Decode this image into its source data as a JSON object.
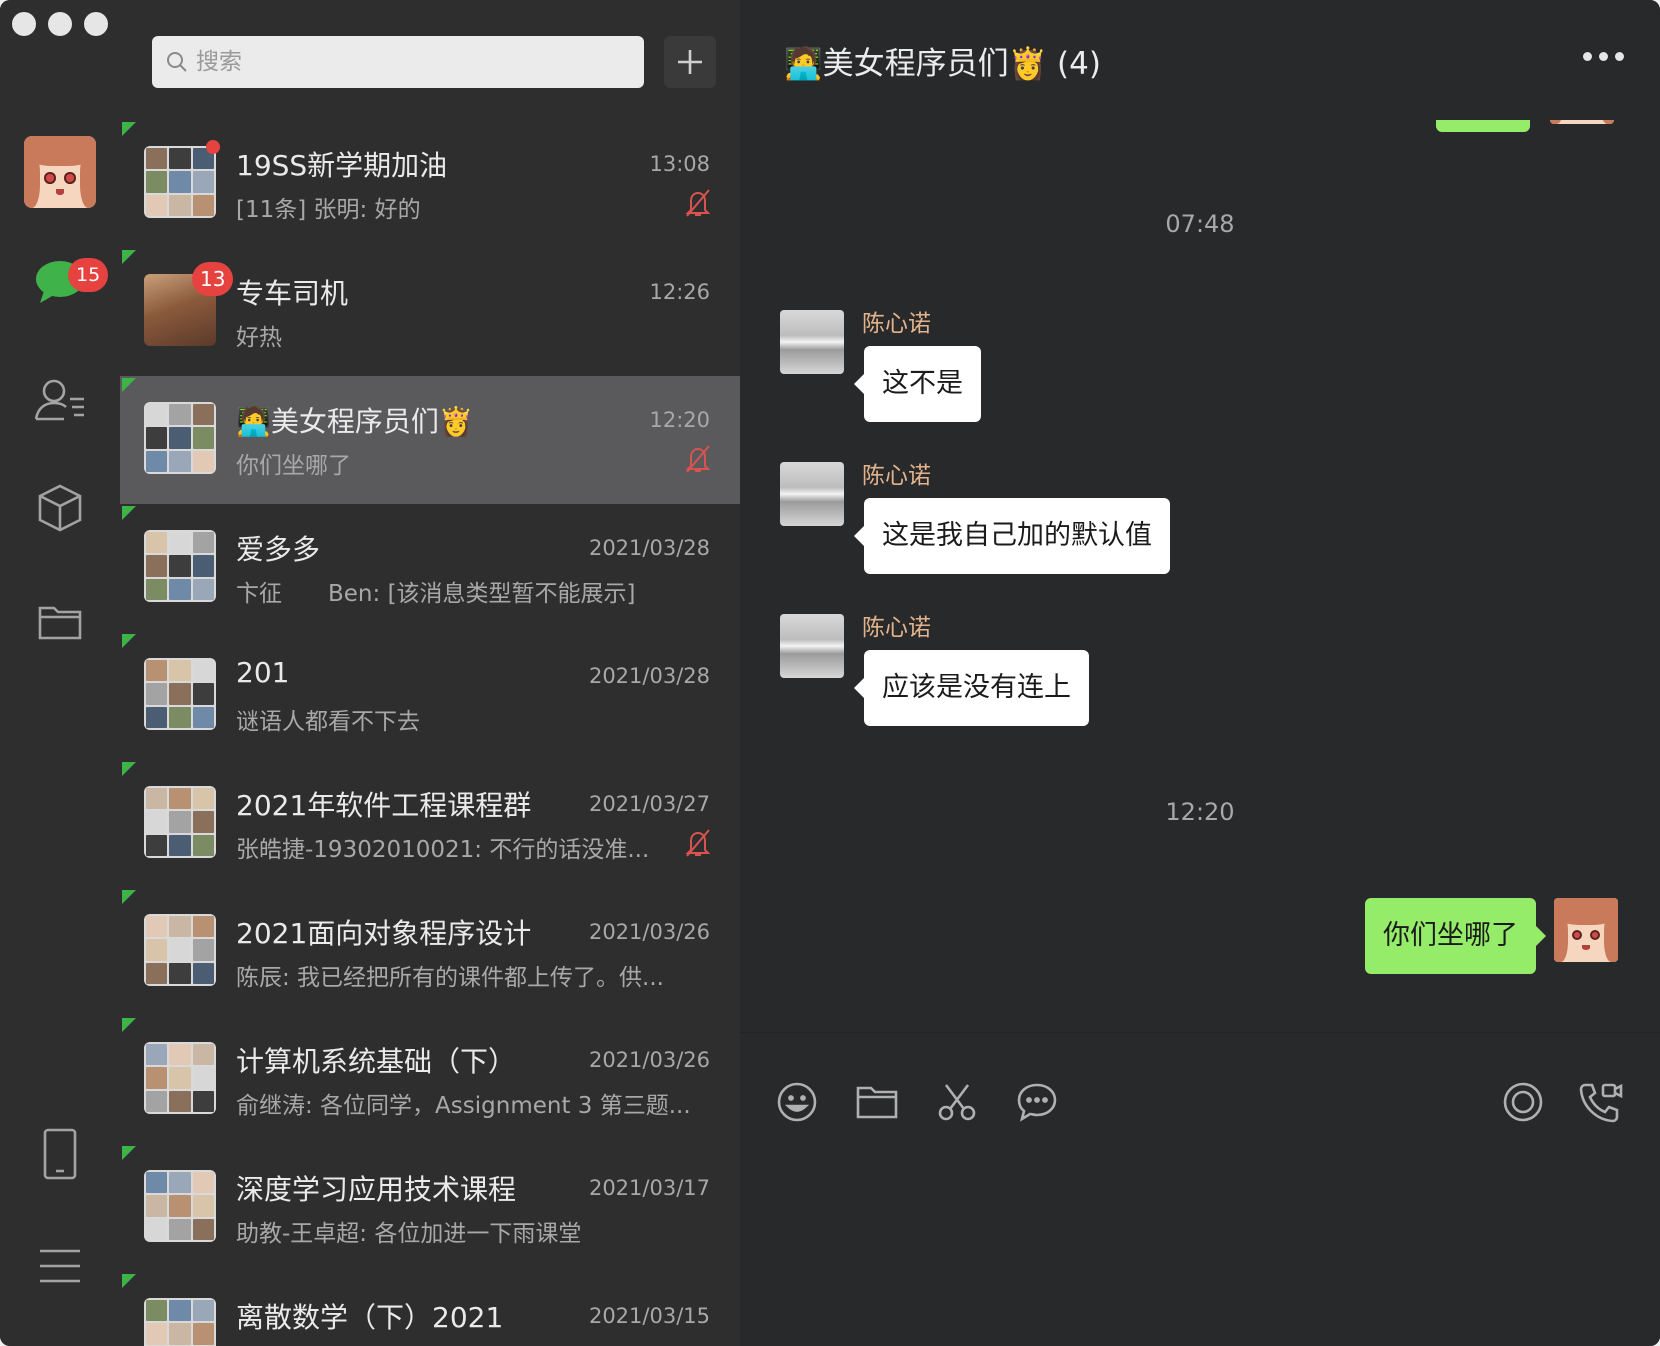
{
  "search": {
    "placeholder": "搜索"
  },
  "rail": {
    "chat_badge": "15"
  },
  "chat": {
    "title": "🧑‍💻美女程序员们👸 (4)",
    "timestamps": [
      "07:48",
      "12:20"
    ],
    "incoming": [
      {
        "sender": "陈心诺",
        "text": "这不是"
      },
      {
        "sender": "陈心诺",
        "text": "这是我自己加的默认值"
      },
      {
        "sender": "陈心诺",
        "text": "应该是没有连上"
      }
    ],
    "outgoing": [
      {
        "text": "你们坐哪了"
      }
    ]
  },
  "conversations": [
    {
      "name": "19SS新学期加油",
      "time": "13:08",
      "preview": "[11条] 张明: 好的",
      "muted": true,
      "dot": true,
      "badge": ""
    },
    {
      "name": "专车司机",
      "time": "12:26",
      "preview": "好热",
      "muted": false,
      "dot": false,
      "badge": "13"
    },
    {
      "name": "🧑‍💻美女程序员们👸",
      "time": "12:20",
      "preview": "你们坐哪了",
      "muted": true,
      "dot": false,
      "badge": "",
      "selected": true
    },
    {
      "name": "爱多多",
      "time": "2021/03/28",
      "preview": "卞征　　Ben: [该消息类型暂不能展示]",
      "muted": false,
      "dot": false,
      "badge": ""
    },
    {
      "name": "201",
      "time": "2021/03/28",
      "preview": "谜语人都看不下去",
      "muted": false,
      "dot": false,
      "badge": ""
    },
    {
      "name": "2021年软件工程课程群",
      "time": "2021/03/27",
      "preview": "张皓捷-19302010021: 不行的话没准...",
      "muted": true,
      "dot": false,
      "badge": ""
    },
    {
      "name": "2021面向对象程序设计",
      "time": "2021/03/26",
      "preview": "陈辰: 我已经把所有的课件都上传了。供...",
      "muted": false,
      "dot": false,
      "badge": ""
    },
    {
      "name": "计算机系统基础（下）",
      "time": "2021/03/26",
      "preview": "俞继涛: 各位同学，Assignment 3 第三题...",
      "muted": false,
      "dot": false,
      "badge": ""
    },
    {
      "name": "深度学习应用技术课程",
      "time": "2021/03/17",
      "preview": "助教-王卓超: 各位加进一下雨课堂",
      "muted": false,
      "dot": false,
      "badge": ""
    },
    {
      "name": "离散数学（下）2021",
      "time": "2021/03/15",
      "preview": "",
      "muted": false,
      "dot": false,
      "badge": ""
    }
  ],
  "colors": {
    "accent_green": "#95ec69",
    "badge_red": "#e64340",
    "sender_name": "#e3b48c",
    "background": "#28292b"
  },
  "icons": [
    "search-icon",
    "plus-icon",
    "chat-icon",
    "contacts-icon",
    "box-icon",
    "folder-icon",
    "phone-icon",
    "menu-icon",
    "more-icon",
    "emoji-icon",
    "file-icon",
    "scissors-icon",
    "chat-bubble-icon",
    "live-icon",
    "call-icon",
    "mute-icon"
  ]
}
